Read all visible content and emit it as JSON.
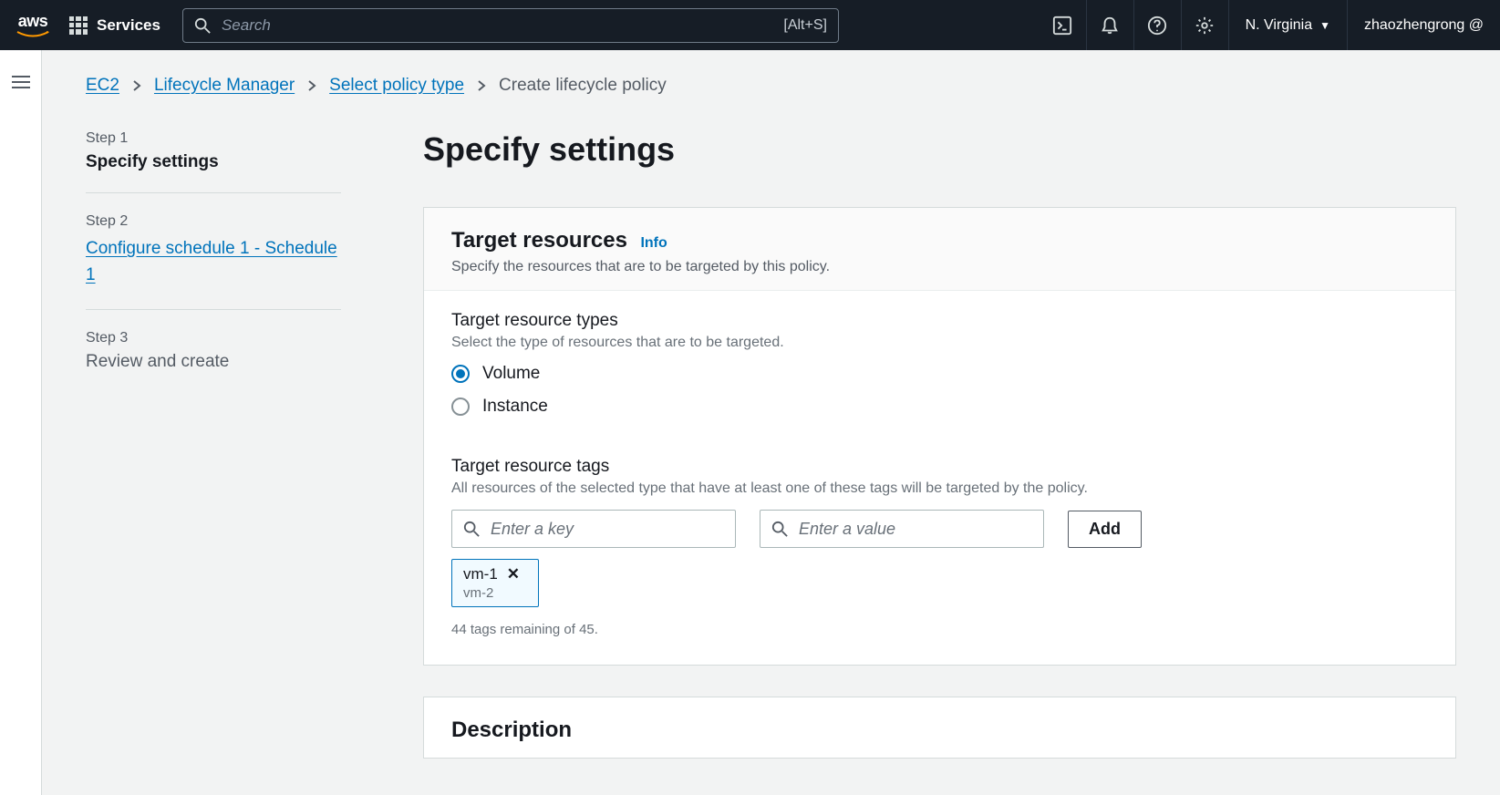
{
  "nav": {
    "logo_text": "aws",
    "services_label": "Services",
    "search_placeholder": "Search",
    "search_hotkey": "[Alt+S]",
    "region": "N. Virginia",
    "account": "zhaozhengrong @"
  },
  "breadcrumb": {
    "items": [
      "EC2",
      "Lifecycle Manager",
      "Select policy type"
    ],
    "current": "Create lifecycle policy"
  },
  "steps": [
    {
      "label": "Step 1",
      "title": "Specify settings",
      "state": "active"
    },
    {
      "label": "Step 2",
      "title": "Configure schedule 1 - Schedule 1",
      "state": "link"
    },
    {
      "label": "Step 3",
      "title": "Review and create",
      "state": "muted"
    }
  ],
  "page_title": "Specify settings",
  "panels": {
    "target": {
      "heading": "Target resources",
      "info": "Info",
      "subheading": "Specify the resources that are to be targeted by this policy.",
      "types": {
        "label": "Target resource types",
        "help": "Select the type of resources that are to be targeted.",
        "options": [
          {
            "label": "Volume",
            "selected": true
          },
          {
            "label": "Instance",
            "selected": false
          }
        ]
      },
      "tags": {
        "label": "Target resource tags",
        "help": "All resources of the selected type that have at least one of these tags will be targeted by the policy.",
        "key_placeholder": "Enter a key",
        "value_placeholder": "Enter a value",
        "add_button": "Add",
        "chip": {
          "key": "vm-1",
          "value": "vm-2"
        },
        "remaining": "44 tags remaining of 45."
      }
    },
    "description": {
      "heading": "Description"
    }
  }
}
